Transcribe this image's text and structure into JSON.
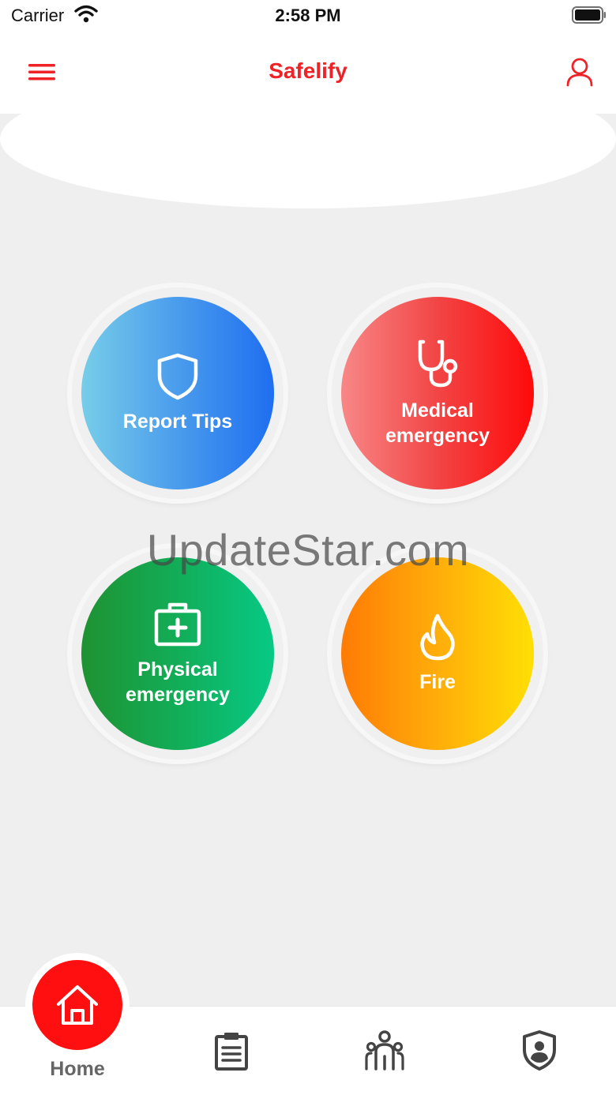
{
  "status_bar": {
    "carrier": "Carrier",
    "time": "2:58 PM"
  },
  "nav": {
    "title": "Safelify"
  },
  "tiles": {
    "report_tips": {
      "label": "Report Tips",
      "icon": "shield-icon"
    },
    "medical": {
      "label": "Medical emergency",
      "icon": "stethoscope-icon"
    },
    "physical": {
      "label": "Physical emergency",
      "icon": "first-aid-kit-icon"
    },
    "fire": {
      "label": "Fire",
      "icon": "flame-icon"
    }
  },
  "watermark": "UpdateStar.com",
  "tab_bar": {
    "home_label": "Home",
    "tabs": [
      "home-icon",
      "clipboard-icon",
      "community-icon",
      "shield-user-icon"
    ]
  },
  "colors": {
    "brand_red": "#ee2227",
    "background": "#efefef",
    "report_tips_gradient": [
      "#77cde9",
      "#1e6ef1"
    ],
    "medical_gradient": [
      "#f88787",
      "#ff0a0a"
    ],
    "physical_gradient": [
      "#1f9232",
      "#07c985"
    ],
    "fire_gradient": [
      "#ff7b05",
      "#ffdf05"
    ]
  }
}
